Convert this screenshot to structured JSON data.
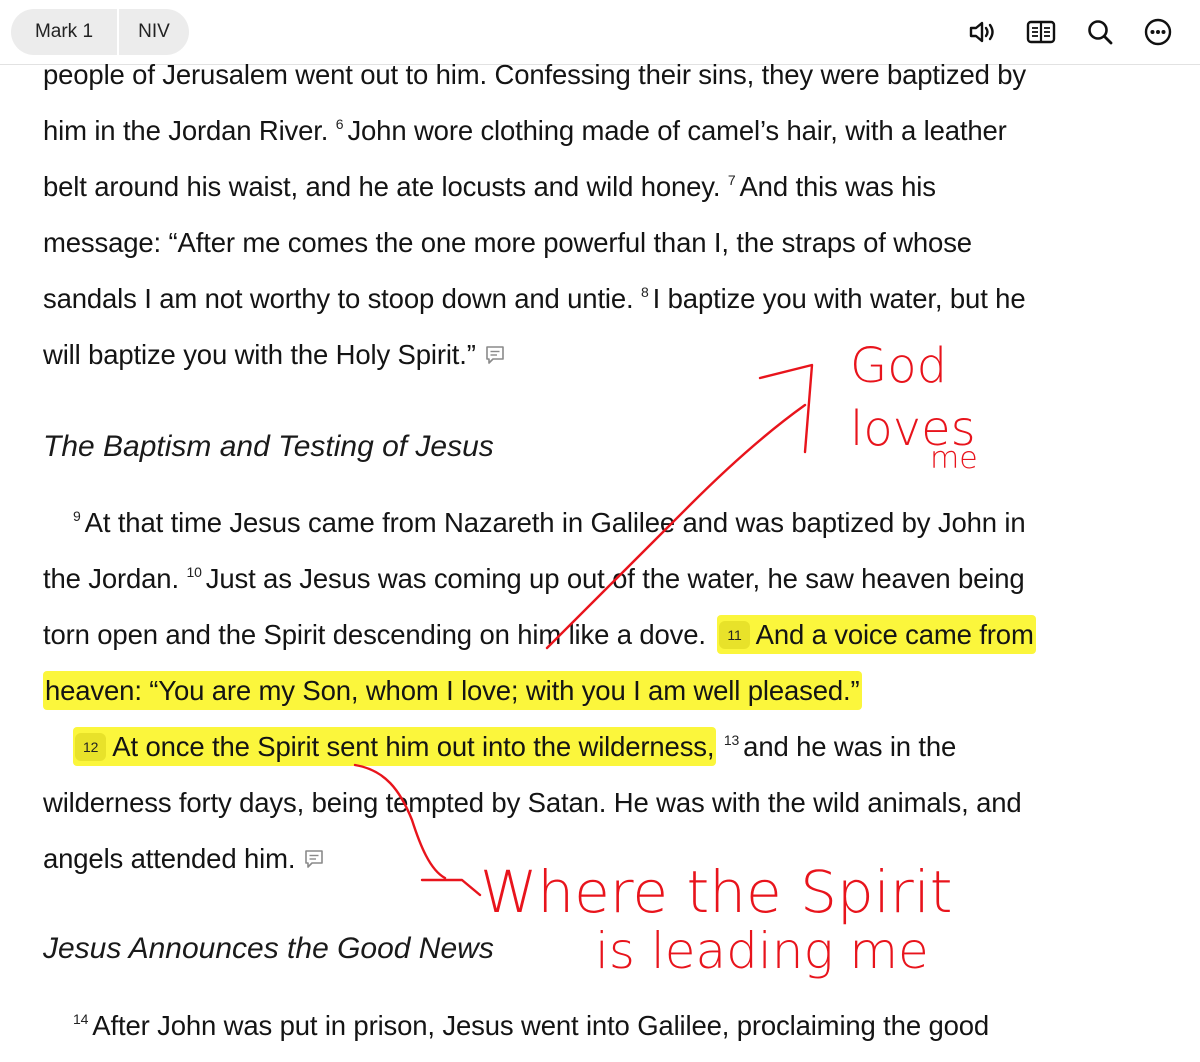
{
  "toolbar": {
    "book_chapter": "Mark 1",
    "version": "NIV",
    "icons": [
      "audio-icon",
      "parallel-icon",
      "search-icon",
      "more-icon"
    ]
  },
  "passage": {
    "line1": "people of Jerusalem went out to him. Confessing their sins, they were baptized by",
    "line2_a": "him in the Jordan River.",
    "v6": "6",
    "line2_b": "John wore clothing made of camel’s hair, with a leather",
    "line3_a": "belt around his waist, and he ate locusts and wild honey.",
    "v7": "7",
    "line3_b": "And this was his",
    "line4": "message: “After me comes the one more powerful than I, the straps of whose",
    "line5_a": "sandals I am not worthy to stoop down and untie.",
    "v8": "8",
    "line5_b": "I baptize you with water, but he",
    "line6": "will baptize you with the Holy Spirit.”",
    "heading1": "The Baptism and Testing of Jesus",
    "v9": "9",
    "line7": "At that time Jesus came from Nazareth in Galilee and was baptized by John in",
    "line8_a": "the Jordan.",
    "v10": "10",
    "line8_b": "Just as Jesus was coming up out of the water, he saw heaven being",
    "line9_a": "torn open and the Spirit descending on him like a dove.",
    "v11": "11",
    "line9_b": "And a voice came from",
    "line10": "heaven: “You are my Son, whom I love; with you I am well pleased.”",
    "v12": "12",
    "line11_a": "At once the Spirit sent him out into the wilderness,",
    "v13": "13",
    "line11_b": "and he was in the",
    "line12": "wilderness forty days, being tempted by Satan. He was with the wild animals, and",
    "line13": "angels attended him.",
    "heading2": "Jesus Announces the Good News",
    "v14": "14",
    "line14": "After John was put in prison, Jesus went into Galilee, proclaiming the good"
  },
  "annotations": {
    "note1_a": "God",
    "note1_b": "loves",
    "note1_c": "me",
    "note2_a": "Where the Spirit",
    "note2_b": "is leading me"
  },
  "colors": {
    "highlight": "#fbf63c",
    "ink": "#e8141c"
  }
}
